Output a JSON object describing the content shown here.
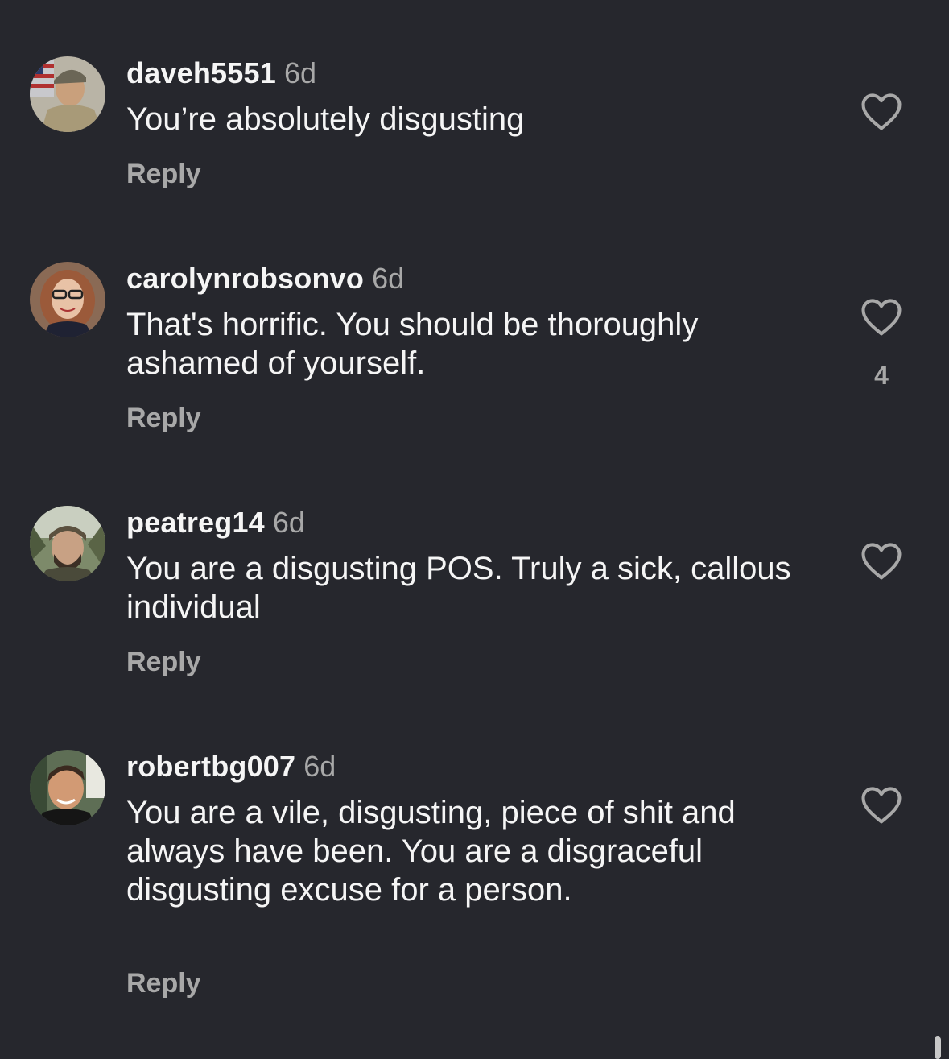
{
  "comments": [
    {
      "username": "daveh5551",
      "time": "6d",
      "text": "You’re absolutely disgusting",
      "reply": "Reply",
      "likes": ""
    },
    {
      "username": "carolynrobsonvo",
      "time": "6d",
      "text": "That's horrific. You should be thoroughly ashamed of yourself.",
      "reply": "Reply",
      "likes": "4"
    },
    {
      "username": "peatreg14",
      "time": "6d",
      "text": "You are a disgusting POS. Truly a sick, callous individual",
      "reply": "Reply",
      "likes": ""
    },
    {
      "username": "robertbg007",
      "time": "6d",
      "text": "You are a vile, disgusting, piece of shit and always have been. You are a disgraceful disgusting excuse for a person.",
      "reply": "Reply",
      "likes": ""
    }
  ],
  "icons": {
    "like": "heart-outline-icon"
  },
  "colors": {
    "background": "#26272d",
    "text": "#f5f5f5",
    "secondary": "#a8a8a8"
  }
}
